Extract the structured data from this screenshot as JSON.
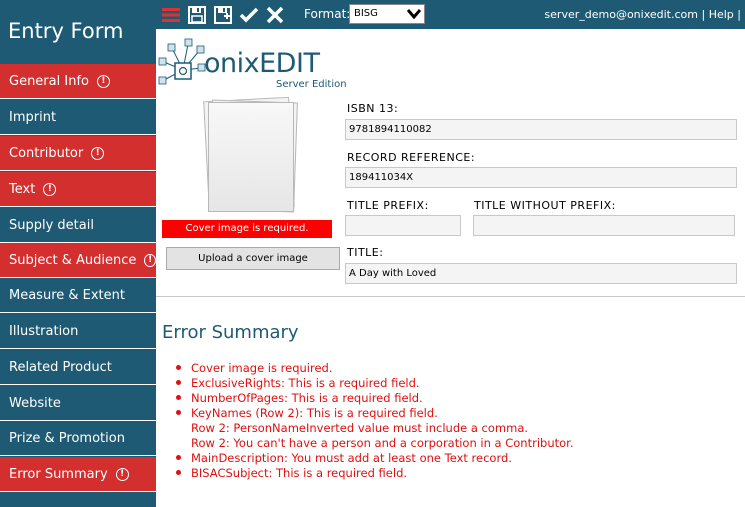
{
  "sidebar": {
    "title": "Entry Form",
    "items": [
      {
        "label": "General Info",
        "error": true
      },
      {
        "label": "Imprint",
        "error": false
      },
      {
        "label": "Contributor",
        "error": true
      },
      {
        "label": "Text",
        "error": true
      },
      {
        "label": "Supply detail",
        "error": false
      },
      {
        "label": "Subject & Audience",
        "error": true
      },
      {
        "label": "Measure & Extent",
        "error": false
      },
      {
        "label": "Illustration",
        "error": false
      },
      {
        "label": "Related Product",
        "error": false
      },
      {
        "label": "Website",
        "error": false
      },
      {
        "label": "Prize & Promotion",
        "error": false
      },
      {
        "label": "Error Summary",
        "error": true
      }
    ],
    "error_glyph": "!"
  },
  "toolbar": {
    "icons": [
      "menu-icon",
      "save-icon",
      "save-as-icon",
      "check-icon",
      "close-icon"
    ],
    "format_label": "Format:",
    "format_value": "BISG",
    "user_link": "server_demo@onixedit.com",
    "separator": "|",
    "help_link": "Help",
    "extra_separator": "|"
  },
  "logo": {
    "text_light": "onix",
    "text_bold": "EDIT",
    "subtitle": "Server Edition"
  },
  "cover": {
    "error": "Cover image is required.",
    "upload_button": "Upload a cover image"
  },
  "fields": {
    "isbn_label": "ISBN 13:",
    "isbn_value": "9781894110082",
    "record_ref_label": "RECORD REFERENCE:",
    "record_ref_value": "189411034X",
    "title_prefix_label": "TITLE PREFIX:",
    "title_prefix_value": "",
    "title_without_prefix_label": "TITLE WITHOUT PREFIX:",
    "title_without_prefix_value": "",
    "title_label": "TITLE:",
    "title_value": "A Day with Loved"
  },
  "summary": {
    "title": "Error Summary",
    "errors": [
      "Cover image is required.",
      "ExclusiveRights: This is a required field.",
      "NumberOfPages: This is a required field.",
      "KeyNames (Row 2): This is a required field.",
      "Row 2: PersonNameInverted value must include a comma.",
      "Row 2: You can't have a person and a corporation in a Contributor.",
      "MainDescription: You must add at least one Text record.",
      "BISACSubject: This is a required field."
    ]
  },
  "colors": {
    "sidebar": "#1e5a74",
    "error_red": "#d32f2f",
    "error_text": "#e01010"
  }
}
